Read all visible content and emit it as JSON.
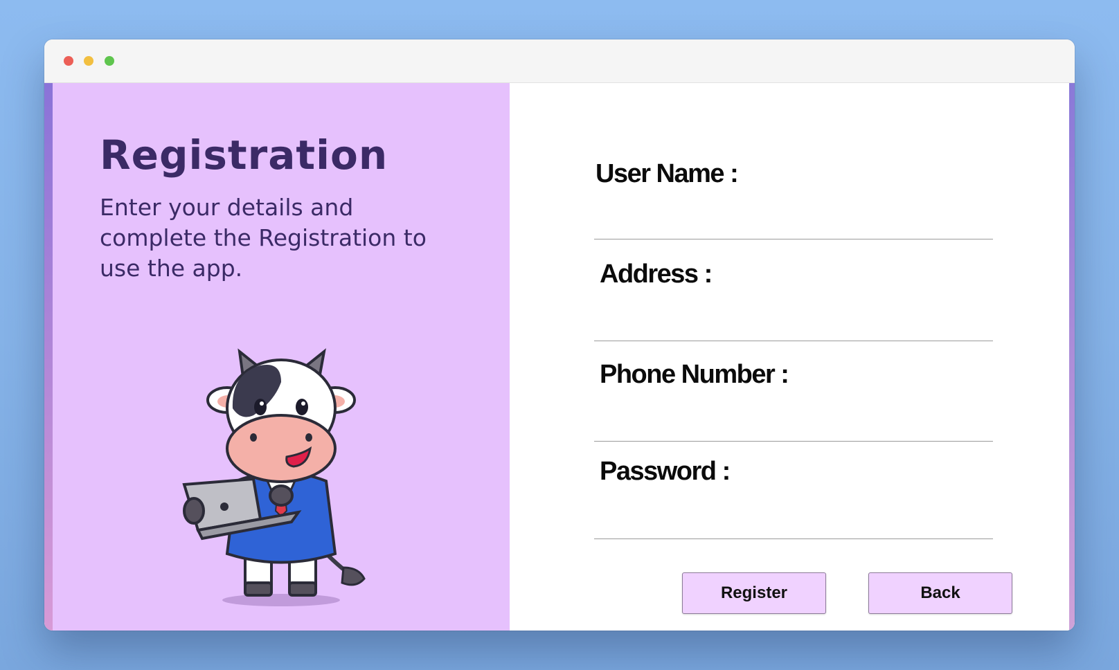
{
  "window": {
    "controls": [
      "close",
      "minimize",
      "zoom"
    ]
  },
  "left": {
    "title": "Registration",
    "subtitle": "Enter your details and complete the Registration to use the app.",
    "illustration": "cow-with-laptop"
  },
  "form": {
    "fields": [
      {
        "label": "User Name :",
        "value": ""
      },
      {
        "label": "Address :",
        "value": ""
      },
      {
        "label": "Phone Number :",
        "value": ""
      },
      {
        "label": "Password :",
        "value": ""
      }
    ],
    "register_label": "Register",
    "back_label": "Back"
  },
  "colors": {
    "background": "#8dbbf0",
    "left_panel": "#e6c1fd",
    "title_text": "#3b2a66",
    "button_bg": "#f0d2ff"
  }
}
